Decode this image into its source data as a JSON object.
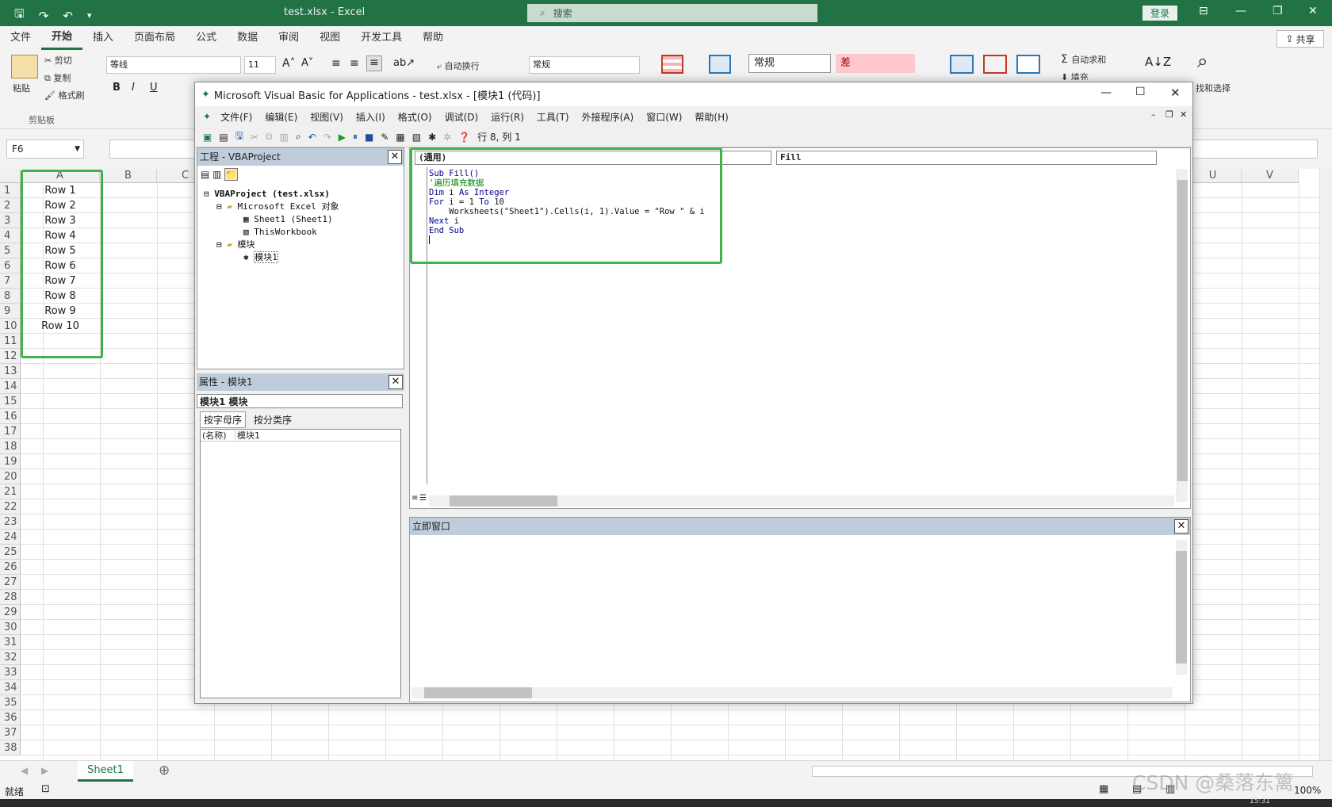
{
  "excel": {
    "doc_title": "test.xlsx  -  Excel",
    "search_placeholder": "搜索",
    "login": "登录",
    "share": "共享",
    "tabs": [
      "文件",
      "开始",
      "插入",
      "页面布局",
      "公式",
      "数据",
      "审阅",
      "视图",
      "开发工具",
      "帮助"
    ],
    "ribbon": {
      "paste": "粘贴",
      "cut": "剪切",
      "copy": "复制",
      "format_painter": "格式刷",
      "clipboard": "剪贴板",
      "font_name": "等线",
      "font_size": "11",
      "wrap": "自动换行",
      "number_format": "常规",
      "style_normal": "常规",
      "style_bad": "差",
      "autosum": "自动求和",
      "fill": "填充",
      "find_select": "找和选择"
    },
    "name_box": "F6",
    "columns": [
      "A",
      "B",
      "C",
      "U",
      "V"
    ],
    "rows": [
      "1",
      "2",
      "3",
      "4",
      "5",
      "6",
      "7",
      "8",
      "9",
      "10",
      "11",
      "12",
      "13",
      "14",
      "15",
      "16",
      "17",
      "18",
      "19",
      "20",
      "21",
      "22",
      "23",
      "24",
      "25",
      "26",
      "27",
      "28",
      "29",
      "30",
      "31",
      "32",
      "33",
      "34",
      "35",
      "36",
      "37",
      "38"
    ],
    "cells_a": [
      "Row 1",
      "Row 2",
      "Row 3",
      "Row 4",
      "Row 5",
      "Row 6",
      "Row 7",
      "Row 8",
      "Row 9",
      "Row 10"
    ],
    "sheet_tab": "Sheet1",
    "status_ready": "就绪",
    "zoom": "100%",
    "time": "15:31"
  },
  "vba": {
    "title": "Microsoft Visual Basic for Applications - test.xlsx - [模块1 (代码)]",
    "menu": [
      "文件(F)",
      "编辑(E)",
      "视图(V)",
      "插入(I)",
      "格式(O)",
      "调试(D)",
      "运行(R)",
      "工具(T)",
      "外接程序(A)",
      "窗口(W)",
      "帮助(H)"
    ],
    "cursor_pos": "行 8, 列 1",
    "project_title": "工程 - VBAProject",
    "tree": {
      "root": "VBAProject (test.xlsx)",
      "excel_objects": "Microsoft Excel 对象",
      "sheet1": "Sheet1 (Sheet1)",
      "thisworkbook": "ThisWorkbook",
      "modules": "模块",
      "module1": "模块1"
    },
    "props_title": "属性 - 模块1",
    "props_combo": "模块1 模块",
    "props_tabs": [
      "按字母序",
      "按分类序"
    ],
    "props_name_key": "(名称)",
    "props_name_val": "模块1",
    "combo_object": "(通用)",
    "combo_proc": "Fill",
    "code": {
      "l1": "Sub Fill()",
      "l2": "'遍历填充数据",
      "l3a": "Dim",
      "l3b": " i ",
      "l3c": "As Integer",
      "l4a": "For",
      "l4b": " i = 1 ",
      "l4c": "To",
      "l4d": " 10",
      "l5": "    Worksheets(\"Sheet1\").Cells(i, 1).Value = \"Row \" & i",
      "l6a": "Next",
      "l6b": " i",
      "l7": "End Sub"
    },
    "immediate_title": "立即窗口"
  },
  "watermark": "CSDN @桑落东篱",
  "colors": {
    "excel_green": "#217346",
    "highlight": "#41b14a",
    "pane_header": "#bfcddb"
  }
}
